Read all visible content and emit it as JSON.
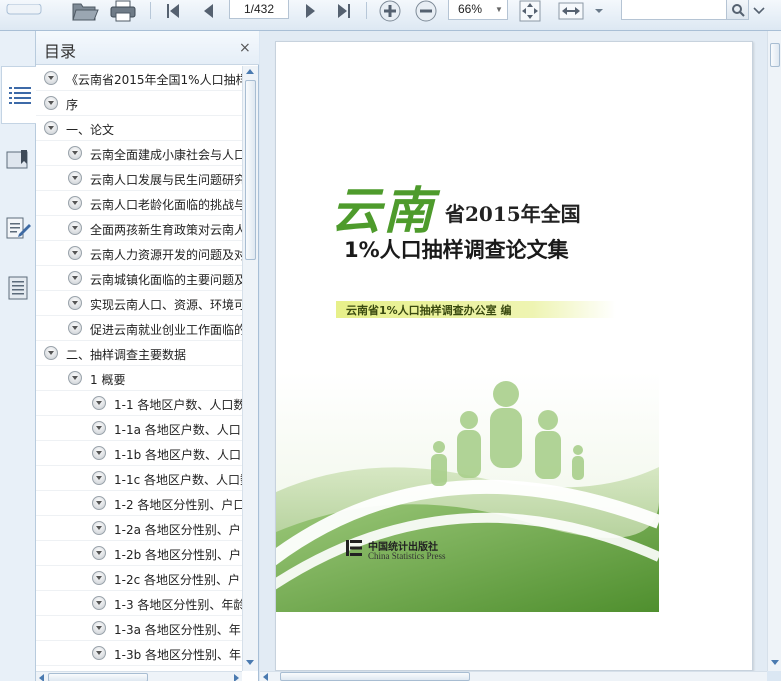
{
  "toolbar": {
    "page_current": "1/432",
    "zoom": "66%",
    "search_placeholder": ""
  },
  "toc": {
    "title": "目录",
    "close": "×",
    "items": [
      {
        "level": 0,
        "label": "《云南省2015年全国1%人口抽样"
      },
      {
        "level": 0,
        "label": "序"
      },
      {
        "level": 0,
        "label": "一、论文"
      },
      {
        "level": 1,
        "label": "云南全面建成小康社会与人口"
      },
      {
        "level": 1,
        "label": "云南人口发展与民生问题研究"
      },
      {
        "level": 1,
        "label": "云南人口老龄化面临的挑战与"
      },
      {
        "level": 1,
        "label": "全面两孩新生育政策对云南人"
      },
      {
        "level": 1,
        "label": "云南人力资源开发的问题及对"
      },
      {
        "level": 1,
        "label": "云南城镇化面临的主要问题及"
      },
      {
        "level": 1,
        "label": "实现云南人口、资源、环境可"
      },
      {
        "level": 1,
        "label": "促进云南就业创业工作面临的"
      },
      {
        "level": 0,
        "label": "二、抽样调查主要数据"
      },
      {
        "level": 1,
        "label": "1 概要"
      },
      {
        "level": 2,
        "label": "1-1 各地区户数、人口数"
      },
      {
        "level": 2,
        "label": "1-1a 各地区户数、人口"
      },
      {
        "level": 2,
        "label": "1-1b 各地区户数、人口"
      },
      {
        "level": 2,
        "label": "1-1c 各地区户数、人口数"
      },
      {
        "level": 2,
        "label": "1-2 各地区分性别、户口"
      },
      {
        "level": 2,
        "label": "1-2a 各地区分性别、户"
      },
      {
        "level": 2,
        "label": "1-2b 各地区分性别、户"
      },
      {
        "level": 2,
        "label": "1-2c 各地区分性别、户"
      },
      {
        "level": 2,
        "label": "1-3 各地区分性别、年龄"
      },
      {
        "level": 2,
        "label": "1-3a 各地区分性别、年"
      },
      {
        "level": 2,
        "label": "1-3b 各地区分性别、年"
      }
    ]
  },
  "cover": {
    "title_big": "云南",
    "title_small": "省2015年全国",
    "title_line2": "1%人口抽样调查论文集",
    "publisher_band": "云南省1%人口抽样调查办公室 编",
    "press_cn": "中国统计出版社",
    "press_en": "China Statistics Press"
  },
  "colors": {
    "accent_green": "#4e9b2c",
    "toolbar_bg": "#dde8f3",
    "panel_border": "#a9bfd6"
  },
  "icons": {
    "toolbar": [
      "open-folder-icon",
      "print-icon",
      "first-page-icon",
      "prev-page-icon",
      "next-page-icon",
      "last-page-icon",
      "zoom-in-icon",
      "zoom-out-icon",
      "fit-page-icon",
      "fit-width-icon",
      "search-icon"
    ],
    "sidebar": [
      "toc-list-icon",
      "bookmark-icon",
      "annotation-icon",
      "page-thumbnail-icon"
    ]
  }
}
